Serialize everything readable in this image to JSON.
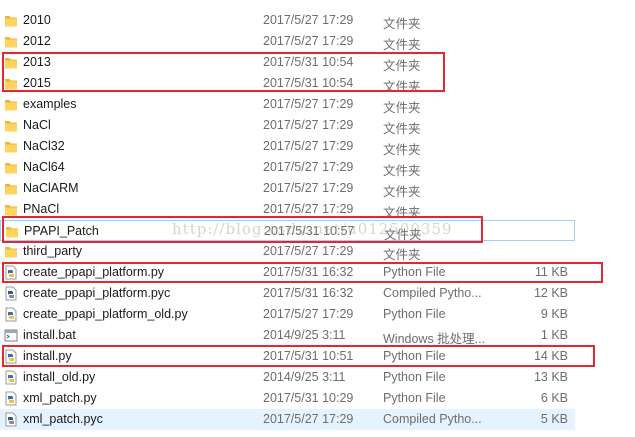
{
  "rows": [
    {
      "name": "2010",
      "date": "2017/5/27 17:29",
      "type": "文件夹",
      "size": "",
      "icon": "folder-icon"
    },
    {
      "name": "2012",
      "date": "2017/5/27 17:29",
      "type": "文件夹",
      "size": "",
      "icon": "folder-icon"
    },
    {
      "name": "2013",
      "date": "2017/5/31 10:54",
      "type": "文件夹",
      "size": "",
      "icon": "folder-icon"
    },
    {
      "name": "2015",
      "date": "2017/5/31 10:54",
      "type": "文件夹",
      "size": "",
      "icon": "folder-icon"
    },
    {
      "name": "examples",
      "date": "2017/5/27 17:29",
      "type": "文件夹",
      "size": "",
      "icon": "folder-icon"
    },
    {
      "name": "NaCl",
      "date": "2017/5/27 17:29",
      "type": "文件夹",
      "size": "",
      "icon": "folder-icon"
    },
    {
      "name": "NaCl32",
      "date": "2017/5/27 17:29",
      "type": "文件夹",
      "size": "",
      "icon": "folder-icon"
    },
    {
      "name": "NaCl64",
      "date": "2017/5/27 17:29",
      "type": "文件夹",
      "size": "",
      "icon": "folder-icon"
    },
    {
      "name": "NaClARM",
      "date": "2017/5/27 17:29",
      "type": "文件夹",
      "size": "",
      "icon": "folder-icon"
    },
    {
      "name": "PNaCl",
      "date": "2017/5/27 17:29",
      "type": "文件夹",
      "size": "",
      "icon": "folder-icon"
    },
    {
      "name": "PPAPI_Patch",
      "date": "2017/5/31 10:57",
      "type": "文件夹",
      "size": "",
      "icon": "folder-icon"
    },
    {
      "name": "third_party",
      "date": "2017/5/27 17:29",
      "type": "文件夹",
      "size": "",
      "icon": "folder-icon"
    },
    {
      "name": "create_ppapi_platform.py",
      "date": "2017/5/31 16:32",
      "type": "Python File",
      "size": "11 KB",
      "icon": "python-file-icon"
    },
    {
      "name": "create_ppapi_platform.pyc",
      "date": "2017/5/31 16:32",
      "type": "Compiled Pytho...",
      "size": "12 KB",
      "icon": "python-compiled-icon"
    },
    {
      "name": "create_ppapi_platform_old.py",
      "date": "2017/5/27 17:29",
      "type": "Python File",
      "size": "9 KB",
      "icon": "python-file-icon"
    },
    {
      "name": "install.bat",
      "date": "2014/9/25 3:11",
      "type": "Windows 批处理...",
      "size": "1 KB",
      "icon": "batch-file-icon"
    },
    {
      "name": "install.py",
      "date": "2017/5/31 10:51",
      "type": "Python File",
      "size": "14 KB",
      "icon": "python-file-icon"
    },
    {
      "name": "install_old.py",
      "date": "2014/9/25 3:11",
      "type": "Python File",
      "size": "13 KB",
      "icon": "python-file-icon"
    },
    {
      "name": "xml_patch.py",
      "date": "2017/5/31 10:29",
      "type": "Python File",
      "size": "6 KB",
      "icon": "python-file-icon"
    },
    {
      "name": "xml_patch.pyc",
      "date": "2017/5/27 17:29",
      "type": "Compiled Pytho...",
      "size": "5 KB",
      "icon": "python-compiled-icon"
    }
  ],
  "watermark": "http://blog.csdn.net/u012500359",
  "colors": {
    "highlight_box": "#e8262f",
    "hover_row": "#e5f3ff",
    "selected_border": "#99d1ff",
    "folder": "#ffd35c"
  }
}
